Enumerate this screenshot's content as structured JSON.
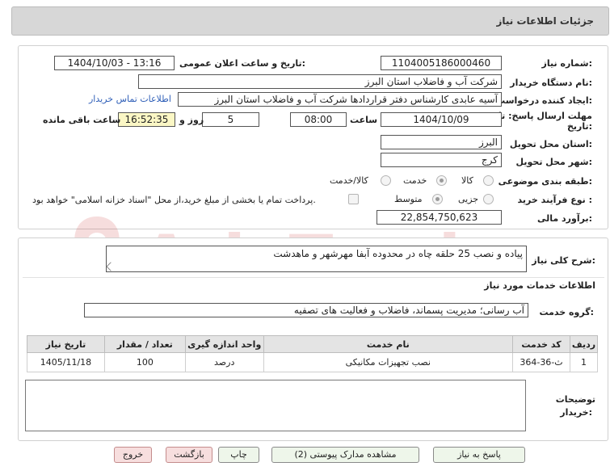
{
  "header": {
    "title": "جزئیات اطلاعات نیاز"
  },
  "details": {
    "need_number_label": "شماره نیاز:",
    "need_number": "1104005186000460",
    "announce_label": "تاریخ و ساعت اعلان عمومی:",
    "announce_value": "1404/10/03 - 13:16",
    "buyer_org_label": "نام دستگاه خریدار:",
    "buyer_org": "شرکت آب و فاضلاب استان البرز",
    "creator_label": "ایجاد کننده درخواست:",
    "creator": "آسیه عابدی کارشناس دفتر قراردادها شرکت آب و فاضلاب استان البرز",
    "contact_link": "اطلاعات تماس خریدار",
    "deadline_label_1": "مهلت ارسال پاسخ: تا",
    "deadline_label_2": "تاریخ:",
    "deadline_date": "1404/10/09",
    "time_label": "ساعت",
    "deadline_time": "08:00",
    "days_value": "5",
    "days_label": "روز و",
    "remaining_time": "16:52:35",
    "remaining_label": "ساعت باقی مانده",
    "province_label": "استان محل تحویل:",
    "province": "البرز",
    "city_label": "شهر محل تحویل:",
    "city": "کرج",
    "category_label": "طبقه بندی موضوعی:",
    "category_options": [
      "کالا",
      "خدمت",
      "کالا/خدمت"
    ],
    "category_selected": "خدمت",
    "process_label": "نوع فرآیند خرید :",
    "process_options": [
      "جزیی",
      "متوسط"
    ],
    "process_selected": "متوسط",
    "payment_note": "پرداخت تمام یا بخشی از مبلغ خرید،از محل \"اسناد خزانه اسلامی\" خواهد بود.",
    "estimate_label": "برآورد مالی:",
    "estimate_value": "22,854,750,623"
  },
  "description": {
    "label": "شرح کلی نیاز:",
    "text": "پیاده و نصب 25 حلقه چاه در محدوده آبفا مهرشهر و ماهدشت"
  },
  "services": {
    "section_title": "اطلاعات خدمات مورد نیاز",
    "group_label": "گروه خدمت:",
    "group_value": "آب رسانی؛ مدیریت پسماند، فاضلاب و فعالیت های تصفیه",
    "columns": [
      "ردیف",
      "کد خدمت",
      "نام خدمت",
      "واحد اندازه گیری",
      "تعداد / مقدار",
      "تاریخ نیاز"
    ],
    "rows": [
      [
        "1",
        "ث-36-364",
        "نصب تجهیزات مکانیکی",
        "درصد",
        "100",
        "1405/11/18"
      ]
    ]
  },
  "buyer_notes": {
    "label_1": "توضیحات",
    "label_2": "خریدار:",
    "text": ""
  },
  "buttons": {
    "reply": "پاسخ به نیاز",
    "attachments": "مشاهده مدارک پیوستی (2)",
    "print": "چاپ",
    "back": "بازگشت",
    "exit": "خروج"
  },
  "watermark": {
    "text": "AriaTender.neT"
  },
  "colors": {
    "header_bg": "#d7d7d7",
    "link": "#2f5fb8",
    "highlight": "#fbf7c5",
    "button_green": "#eef6ea",
    "button_red": "#f7dede"
  }
}
